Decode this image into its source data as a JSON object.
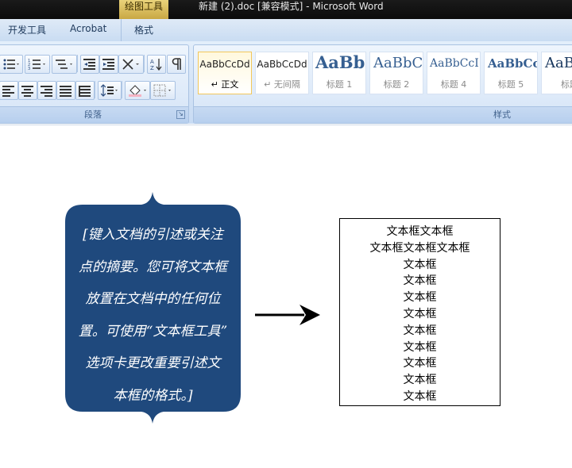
{
  "titlebar": {
    "context_tab": "绘图工具",
    "doc_title": "新建 (2).doc [兼容模式] - Microsoft Word"
  },
  "tabs": [
    {
      "label": "开发工具"
    },
    {
      "label": "Acrobat"
    },
    {
      "label": "格式"
    }
  ],
  "ribbon": {
    "paragraph_group_label": "段落",
    "styles_group_label": "样式",
    "styles": [
      {
        "sample": "AaBbCcDd",
        "name": "↵ 正文"
      },
      {
        "sample": "AaBbCcDd",
        "name": "↵ 无间隔"
      },
      {
        "sample": "AaBb",
        "name": "标题 1"
      },
      {
        "sample": "AaBbC",
        "name": "标题 2"
      },
      {
        "sample": "AaBbCcI",
        "name": "标题 4"
      },
      {
        "sample": "AaBbCc",
        "name": "标题 5"
      },
      {
        "sample": "AaB",
        "name": "标题"
      }
    ]
  },
  "document": {
    "quote_lines": [
      "[键入文档的引述或关注",
      "点的摘要。您可将文本框",
      "放置在文档中的任何位",
      "置。可使用“文本框工具”",
      "选项卡更改重要引述文",
      "本框的格式。]"
    ],
    "textbox_lines": [
      "文本框文本框",
      "文本框文本框文本框",
      "文本框",
      "文本框",
      "文本框",
      "文本框",
      "文本框",
      "文本框",
      "文本框",
      "文本框",
      "文本框"
    ],
    "quote_box_color": "#1f497d"
  }
}
